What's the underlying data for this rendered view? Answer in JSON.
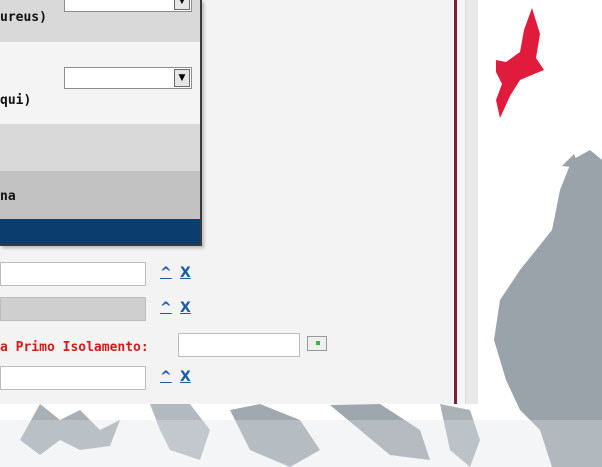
{
  "popup": {
    "label_1": "ureus)",
    "label_2": "qui)",
    "label_3": "na",
    "dropdown_arrow": "▼"
  },
  "form": {
    "row_1": {
      "up": "^",
      "clear": "X"
    },
    "row_2": {
      "up": "^",
      "clear": "X"
    },
    "date_label": "a Primo Isolamento:",
    "row_4": {
      "up": "^",
      "clear": "X"
    }
  },
  "icons": {
    "calendar": "calendar-icon",
    "dropdown": "chevron-down-icon"
  },
  "colors": {
    "label_red": "#d31b1b",
    "link_blue": "#1a5aa8",
    "popup_footer": "#0b3d6f",
    "logo_red": "#e01b3c"
  }
}
